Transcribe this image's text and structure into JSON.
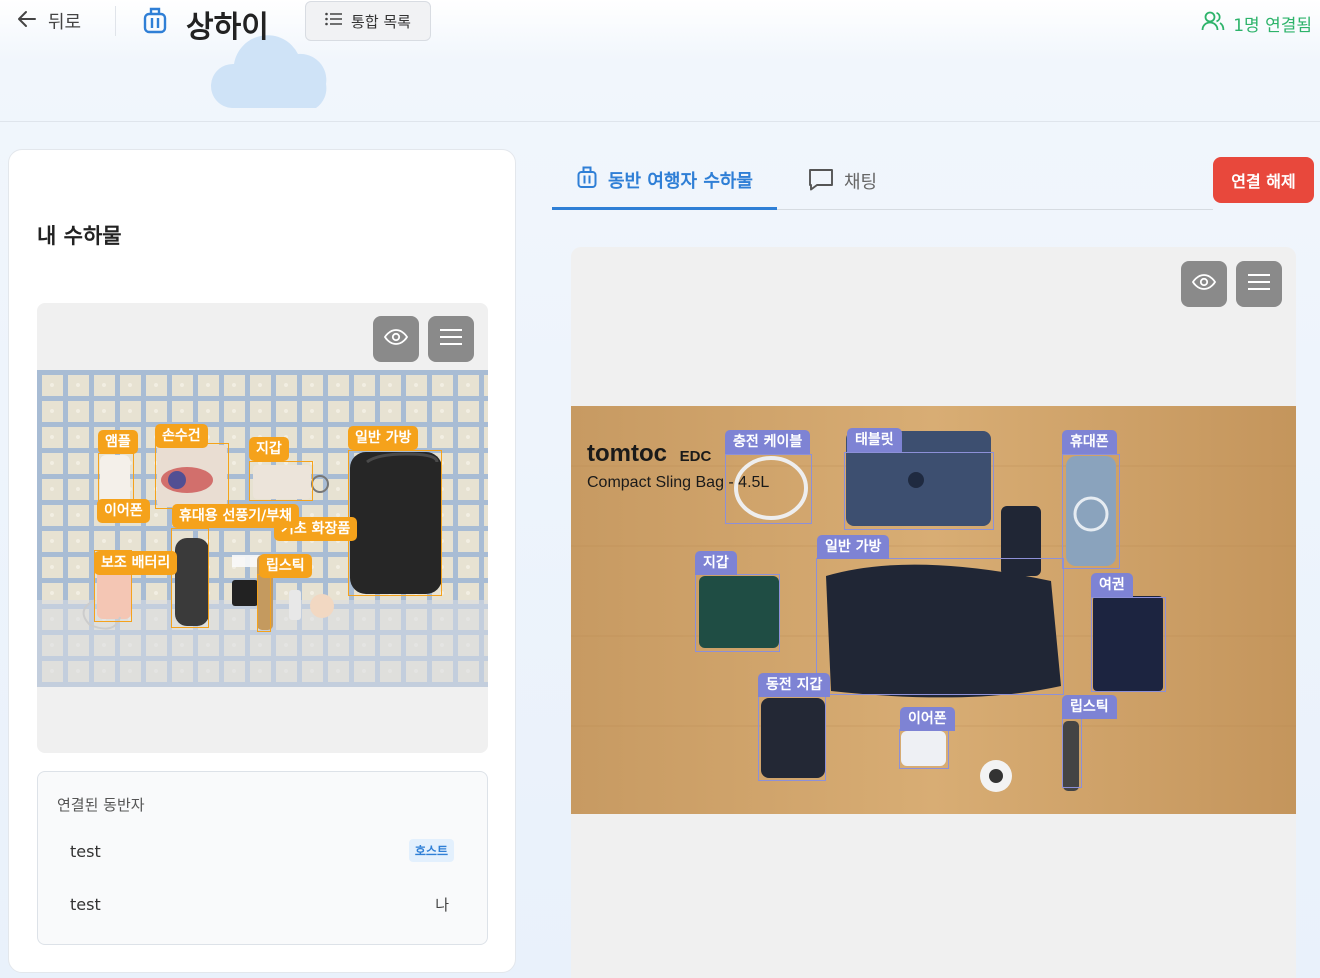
{
  "header": {
    "back_label": "뒤로",
    "title": "상하이",
    "list_button_label": "통합 목록",
    "connected_status": "1명 연결됨"
  },
  "left": {
    "section_title": "내 수하물",
    "detections": [
      {
        "label": "앰플"
      },
      {
        "label": "손수건"
      },
      {
        "label": "지갑"
      },
      {
        "label": "일반 가방"
      },
      {
        "label": "이어폰"
      },
      {
        "label": "휴대용 선풍기/부채"
      },
      {
        "label": "보조 배터리"
      },
      {
        "label": "립스틱"
      },
      {
        "label": "기초 화장품"
      }
    ],
    "companions": {
      "title": "연결된 동반자",
      "rows": [
        {
          "name": "test",
          "badge": "호스트"
        },
        {
          "name": "test",
          "badge": "나"
        }
      ]
    }
  },
  "right": {
    "tabs": [
      {
        "label": "동반 여행자 수하물",
        "active": true
      },
      {
        "label": "채팅",
        "active": false
      }
    ],
    "disconnect_label": "연결 해제",
    "photo_brand": "tomtoc",
    "photo_brand_sub": "EDC",
    "photo_caption": "Compact Sling Bag - 4.5L",
    "detections": [
      {
        "label": "충전 케이블"
      },
      {
        "label": "태블릿"
      },
      {
        "label": "휴대폰"
      },
      {
        "label": "지갑"
      },
      {
        "label": "일반 가방"
      },
      {
        "label": "여권"
      },
      {
        "label": "동전 지갑"
      },
      {
        "label": "이어폰"
      },
      {
        "label": "립스틱"
      }
    ]
  },
  "colors": {
    "accent": "#2f7fd6",
    "connected": "#2db36a",
    "danger": "#e8483c",
    "detection_left": "#f5a21b",
    "detection_right": "#7e83d4"
  }
}
